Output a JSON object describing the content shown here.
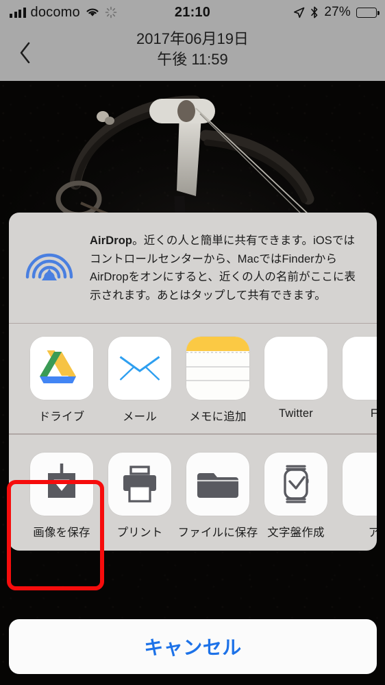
{
  "status_bar": {
    "carrier": "docomo",
    "signal_bars": 4,
    "wifi_icon": "wifi-icon",
    "activity_icon": "activity-spinner-icon",
    "time": "21:10",
    "location_icon": "location-arrow-icon",
    "bluetooth_icon": "bluetooth-icon",
    "battery_percent": "27%",
    "battery_level": 27
  },
  "nav_bar": {
    "back_icon": "chevron-left-icon",
    "date": "2017年06月19日",
    "time": "午後 11:59"
  },
  "photo": {
    "description_icon": "photo-dark-apparatus"
  },
  "share_sheet": {
    "airdrop": {
      "icon": "airdrop-icon",
      "title": "AirDrop",
      "body": "。近くの人と簡単に共有できます。iOSではコントロールセンターから、MacではFinderからAirDropをオンにすると、近くの人の名前がここに表示されます。あとはタップして共有できます。"
    },
    "apps": [
      {
        "label": "ドライブ",
        "icon": "google-drive-icon"
      },
      {
        "label": "メール",
        "icon": "mail-icon"
      },
      {
        "label": "メモに追加",
        "icon": "notes-icon"
      },
      {
        "label": "Twitter",
        "icon": "twitter-icon"
      },
      {
        "label": "F",
        "icon": "facebook-icon"
      }
    ],
    "actions": [
      {
        "label": "画像を保存",
        "icon": "save-image-icon",
        "highlighted": true
      },
      {
        "label": "プリント",
        "icon": "printer-icon",
        "highlighted": false
      },
      {
        "label": "ファイルに保存",
        "icon": "folder-icon",
        "highlighted": false
      },
      {
        "label": "文字盤作成",
        "icon": "apple-watch-icon",
        "highlighted": false
      },
      {
        "label": "ア",
        "icon": "more-action-icon",
        "highlighted": false
      }
    ],
    "cancel_label": "キャンセル"
  },
  "annotation": {
    "color": "#f60c0c",
    "target": "画像を保存"
  },
  "colors": {
    "accent_blue": "#1d72e8",
    "airdrop_blue": "#4a7fe0",
    "annotation_red": "#f60c0c",
    "sheet_background": "#d5d3d1",
    "chrome_gray": "#a9a9a9"
  }
}
